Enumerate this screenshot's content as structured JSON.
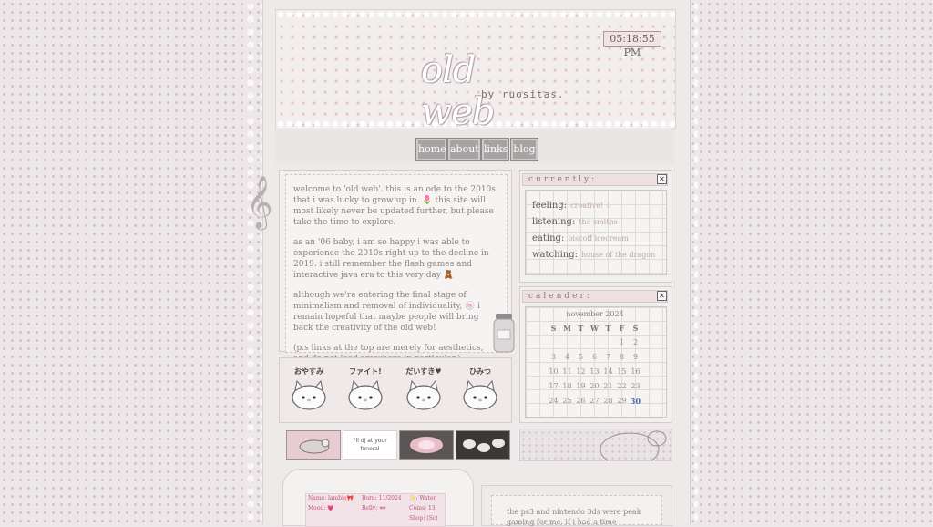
{
  "clock": "05:18:55 PM",
  "site": {
    "title": "old web",
    "byline": "by ruositas."
  },
  "nav": [
    {
      "label": "home"
    },
    {
      "label": "about"
    },
    {
      "label": "links"
    },
    {
      "label": "blog"
    }
  ],
  "intro": {
    "p1": "welcome to 'old web'. this is an ode to the 2010s that i was lucky to grow up in. 🌷 this site will most likely never be updated further, but please take the time to explore.",
    "p2": "as an '06 baby, i am so happy i was able to experience the 2010s right up to the decline in 2019. i still remember the flash games and interactive java era to this very day 🧸",
    "p3": "although we're entering the final stage of minimalism and removal of individuality, 🍥 i remain hopeful that maybe people will bring back the creativity of the old web!",
    "p4": "(p.s links at the top are merely for aesthetics, and do not lead anywhere in particular.)"
  },
  "currently": {
    "title": "currently:",
    "close": "✕",
    "rows": [
      {
        "label": "feeling:",
        "value": "creative! ☆"
      },
      {
        "label": "listening:",
        "value": "the smiths"
      },
      {
        "label": "eating:",
        "value": "biscoff icecream"
      },
      {
        "label": "watching:",
        "value": "house of the dragon"
      }
    ]
  },
  "calendar": {
    "title": "calender:",
    "close": "✕",
    "month": "november 2024",
    "weekdays": [
      "S",
      "M",
      "T",
      "W",
      "T",
      "F",
      "S"
    ],
    "weeks": [
      [
        "",
        "",
        "",
        "",
        "",
        "1",
        "2"
      ],
      [
        "3",
        "4",
        "5",
        "6",
        "7",
        "8",
        "9"
      ],
      [
        "10",
        "11",
        "12",
        "13",
        "14",
        "15",
        "16"
      ],
      [
        "17",
        "18",
        "19",
        "20",
        "21",
        "22",
        "23"
      ],
      [
        "24",
        "25",
        "26",
        "27",
        "28",
        "29",
        "30"
      ]
    ],
    "today": "30"
  },
  "stickers": [
    {
      "text": "おやすみ"
    },
    {
      "text": "ファイト!"
    },
    {
      "text": "だいすき♥"
    },
    {
      "text": "ひみつ"
    }
  ],
  "buttons": [
    {
      "text": ""
    },
    {
      "text": "i'll dj at your funeral"
    },
    {
      "text": ""
    },
    {
      "text": ""
    }
  ],
  "profile": {
    "name": "Name: lambie🎀",
    "born": "Born: 11/2024",
    "element": "✨: Water",
    "mood": "Mood: 💗",
    "belly": "Belly: 🕶",
    "coins": "Coins: 13",
    "shop": "Shop: (Sc)"
  },
  "note": "the ps3 and nintendo 3ds were peak gaming for me. if i had a time"
}
